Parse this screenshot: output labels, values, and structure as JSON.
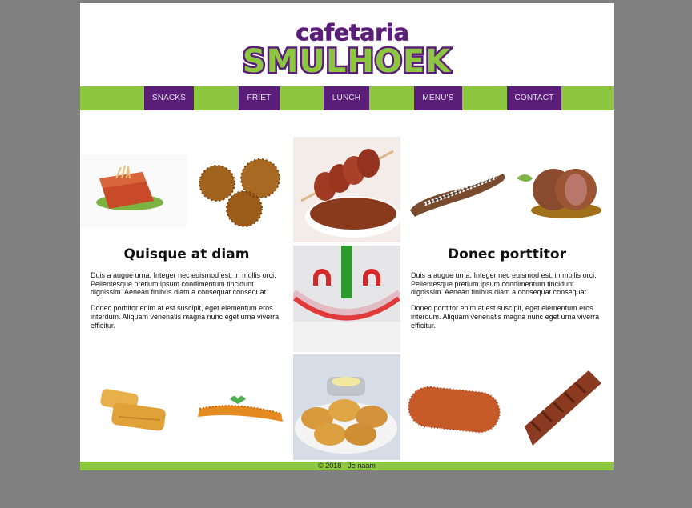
{
  "logo": {
    "line1": "cafetaria",
    "line2": "SMULHOEK"
  },
  "nav": {
    "items": [
      {
        "label": "SNACKS"
      },
      {
        "label": "FRIET"
      },
      {
        "label": "LUNCH"
      },
      {
        "label": "MENU'S"
      },
      {
        "label": "CONTACT"
      }
    ]
  },
  "columns": [
    {
      "title": "Quisque at diam",
      "paragraphs": [
        "Duis a augue urna. Integer nec euismod est, in mollis orci. Pellentesque pretium ipsum condimentum tincidunt dignissim. Aenean finibus diam a consequat consequat.",
        "Donec porttitor enim at est suscipit, eget elementum eros interdum. Aliquam venenatis magna nunc eget urna viverra efficitur."
      ]
    },
    {
      "title": "Donec porttitor",
      "paragraphs": [
        "Duis a augue urna. Integer nec euismod est, in mollis orci. Pellentesque pretium ipsum condimentum tincidunt dignissim. Aenean finibus diam a consequat consequat.",
        "Donec porttitor enim at est suscipit, eget elementum eros interdum. Aliquam venenatis magna nunc eget urna viverra efficitur."
      ]
    }
  ],
  "footer": {
    "text": "© 2018 - Je naam"
  },
  "colors": {
    "nav_bar": "#8dc63f",
    "nav_item": "#5a1e78",
    "page_bg": "#808080"
  }
}
